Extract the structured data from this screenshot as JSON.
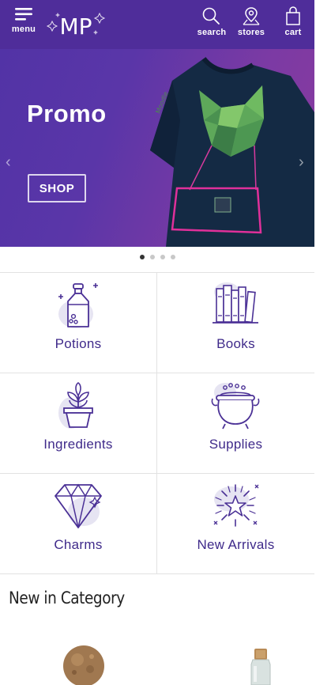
{
  "header": {
    "menu_label": "menu",
    "logo_text": "MP",
    "search_label": "search",
    "stores_label": "stores",
    "cart_label": "cart",
    "background_color": "#4f2d9a"
  },
  "banner": {
    "title": "Promo",
    "button_label": "SHOP",
    "prev_arrow": "‹",
    "next_arrow": "›",
    "slide_count": 4,
    "active_slide": 1
  },
  "categories": [
    {
      "label": "Potions",
      "icon": "potion-bottle-icon"
    },
    {
      "label": "Books",
      "icon": "books-icon"
    },
    {
      "label": "Ingredients",
      "icon": "plant-pot-icon"
    },
    {
      "label": "Supplies",
      "icon": "cauldron-icon"
    },
    {
      "label": "Charms",
      "icon": "diamond-icon"
    },
    {
      "label": "New Arrivals",
      "icon": "sparkle-star-icon"
    }
  ],
  "section": {
    "title": "New in Category"
  },
  "colors": {
    "accent": "#4f2d9a",
    "category_text": "#3f2a8a",
    "icon_stroke": "#4b3196",
    "icon_blob": "#e6e4f2"
  }
}
